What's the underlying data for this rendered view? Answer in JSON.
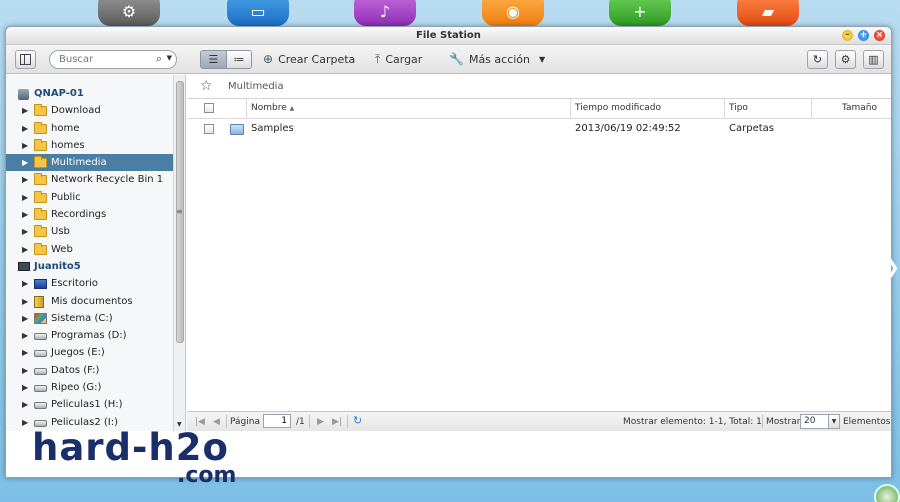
{
  "launcher": {
    "apps": [
      {
        "icon": "gear-icon",
        "glyph": "⚙"
      },
      {
        "icon": "photo-station-icon",
        "glyph": "▭"
      },
      {
        "icon": "music-station-icon",
        "glyph": "♪"
      },
      {
        "icon": "download-station-icon",
        "glyph": "◉"
      },
      {
        "icon": "app-center-icon",
        "glyph": "+"
      },
      {
        "icon": "file-station-icon",
        "glyph": "▰"
      }
    ]
  },
  "window": {
    "title": "File Station",
    "controls": {
      "minimize": "–",
      "maximize": "+",
      "close": "×"
    }
  },
  "toolbar": {
    "search_placeholder": "Buscar",
    "create_folder_label": "Crear Carpeta",
    "upload_label": "Cargar",
    "more_actions_label": "Más acción"
  },
  "sidebar": {
    "items": [
      {
        "label": "QNAP-01",
        "type": "root-server"
      },
      {
        "label": "Download",
        "type": "folder"
      },
      {
        "label": "home",
        "type": "folder"
      },
      {
        "label": "homes",
        "type": "folder"
      },
      {
        "label": "Multimedia",
        "type": "folder",
        "selected": true
      },
      {
        "label": "Network Recycle Bin 1",
        "type": "folder"
      },
      {
        "label": "Public",
        "type": "folder"
      },
      {
        "label": "Recordings",
        "type": "folder"
      },
      {
        "label": "Usb",
        "type": "folder"
      },
      {
        "label": "Web",
        "type": "folder"
      },
      {
        "label": "Juanito5",
        "type": "root-pc"
      },
      {
        "label": "Escritorio",
        "type": "desktop"
      },
      {
        "label": "Mis documentos",
        "type": "documents"
      },
      {
        "label": "Sistema (C:)",
        "type": "system-drive"
      },
      {
        "label": "Programas (D:)",
        "type": "drive"
      },
      {
        "label": "Juegos (E:)",
        "type": "drive"
      },
      {
        "label": "Datos (F:)",
        "type": "drive"
      },
      {
        "label": "Ripeo (G:)",
        "type": "drive"
      },
      {
        "label": "Peliculas1 (H:)",
        "type": "drive"
      },
      {
        "label": "Peliculas2 (I:)",
        "type": "drive"
      }
    ]
  },
  "main": {
    "breadcrumb": "Multimedia",
    "columns": {
      "name": "Nombre",
      "modified": "Tiempo modificado",
      "type": "Tipo",
      "size": "Tamaño"
    },
    "rows": [
      {
        "name": "Samples",
        "modified": "2013/06/19 02:49:52",
        "type": "Carpetas",
        "size": ""
      }
    ]
  },
  "pager": {
    "page_label": "Página",
    "page_value": "1",
    "page_total": "/1",
    "summary": "Mostrar elemento: 1-1, Total: 1",
    "show_label": "Mostrar",
    "per_page": "20",
    "items_label": "Elementos"
  },
  "watermark": {
    "line1": "hard-h2o",
    "line2": ".com"
  }
}
